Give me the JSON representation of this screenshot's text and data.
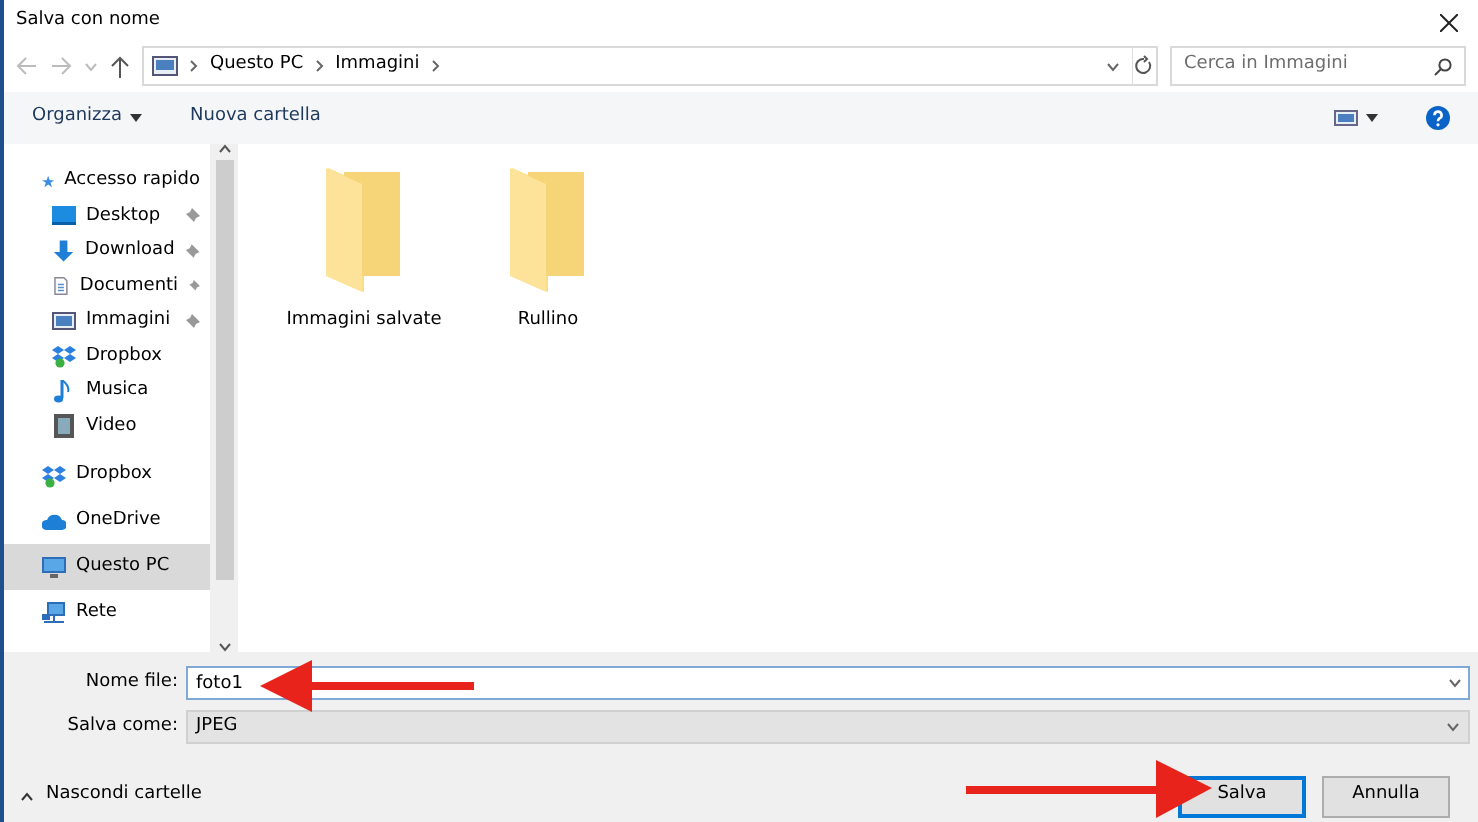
{
  "window": {
    "title": "Salva con nome"
  },
  "address": {
    "path": [
      "Questo PC",
      "Immagini"
    ],
    "search_placeholder": "Cerca in Immagini"
  },
  "toolbar": {
    "buttons": [
      "Organizza",
      "Nuova cartella"
    ]
  },
  "sidebar": {
    "items": [
      {
        "label": "Accesso rapido",
        "selected": false,
        "children": [
          {
            "label": "Desktop",
            "pinned": true,
            "selected": false
          },
          {
            "label": "Download",
            "pinned": true,
            "selected": false
          },
          {
            "label": "Documenti",
            "pinned": true,
            "selected": false
          },
          {
            "label": "Immagini",
            "pinned": true,
            "selected": false
          },
          {
            "label": "Dropbox",
            "pinned": false,
            "selected": false
          },
          {
            "label": "Musica",
            "pinned": false,
            "selected": false
          },
          {
            "label": "Video",
            "pinned": false,
            "selected": false
          }
        ]
      },
      {
        "label": "Dropbox",
        "selected": false
      },
      {
        "label": "OneDrive",
        "selected": false
      },
      {
        "label": "Questo PC",
        "selected": true
      },
      {
        "label": "Rete",
        "selected": false
      }
    ]
  },
  "folders": [
    {
      "name": "Immagini salvate"
    },
    {
      "name": "Rullino"
    }
  ],
  "form": {
    "file_name_label": "Nome file:",
    "file_name": "foto1",
    "type_label": "Salva come:",
    "type": "JPEG"
  },
  "footer": {
    "toggle": "Nascondi cartelle",
    "buttons": [
      {
        "label": "Salva",
        "default": true
      },
      {
        "label": "Annulla",
        "default": false
      }
    ]
  }
}
